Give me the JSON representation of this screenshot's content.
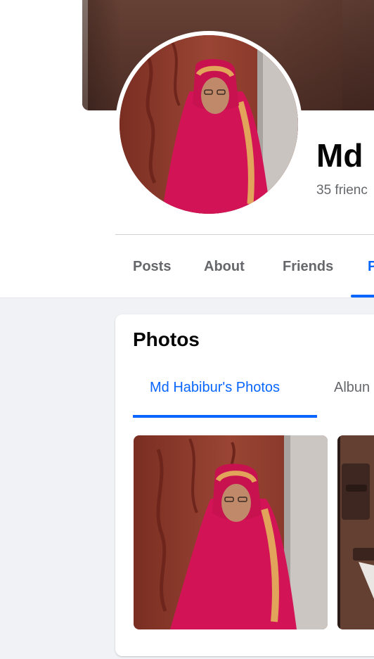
{
  "profile": {
    "name": "Md",
    "friends_count": "35 frienc"
  },
  "tabs": [
    {
      "label": "Posts"
    },
    {
      "label": "About"
    },
    {
      "label": "Friends"
    },
    {
      "label": "P"
    }
  ],
  "photos_section": {
    "title": "Photos",
    "tabs": [
      {
        "label": "Md Habibur's Photos"
      },
      {
        "label": "Albun"
      }
    ]
  },
  "colors": {
    "accent": "#0866ff",
    "text_primary": "#050505",
    "text_secondary": "#65676b",
    "page_background": "#f0f2f5",
    "scarf": "#d21457",
    "door": "#8e3a2c"
  }
}
